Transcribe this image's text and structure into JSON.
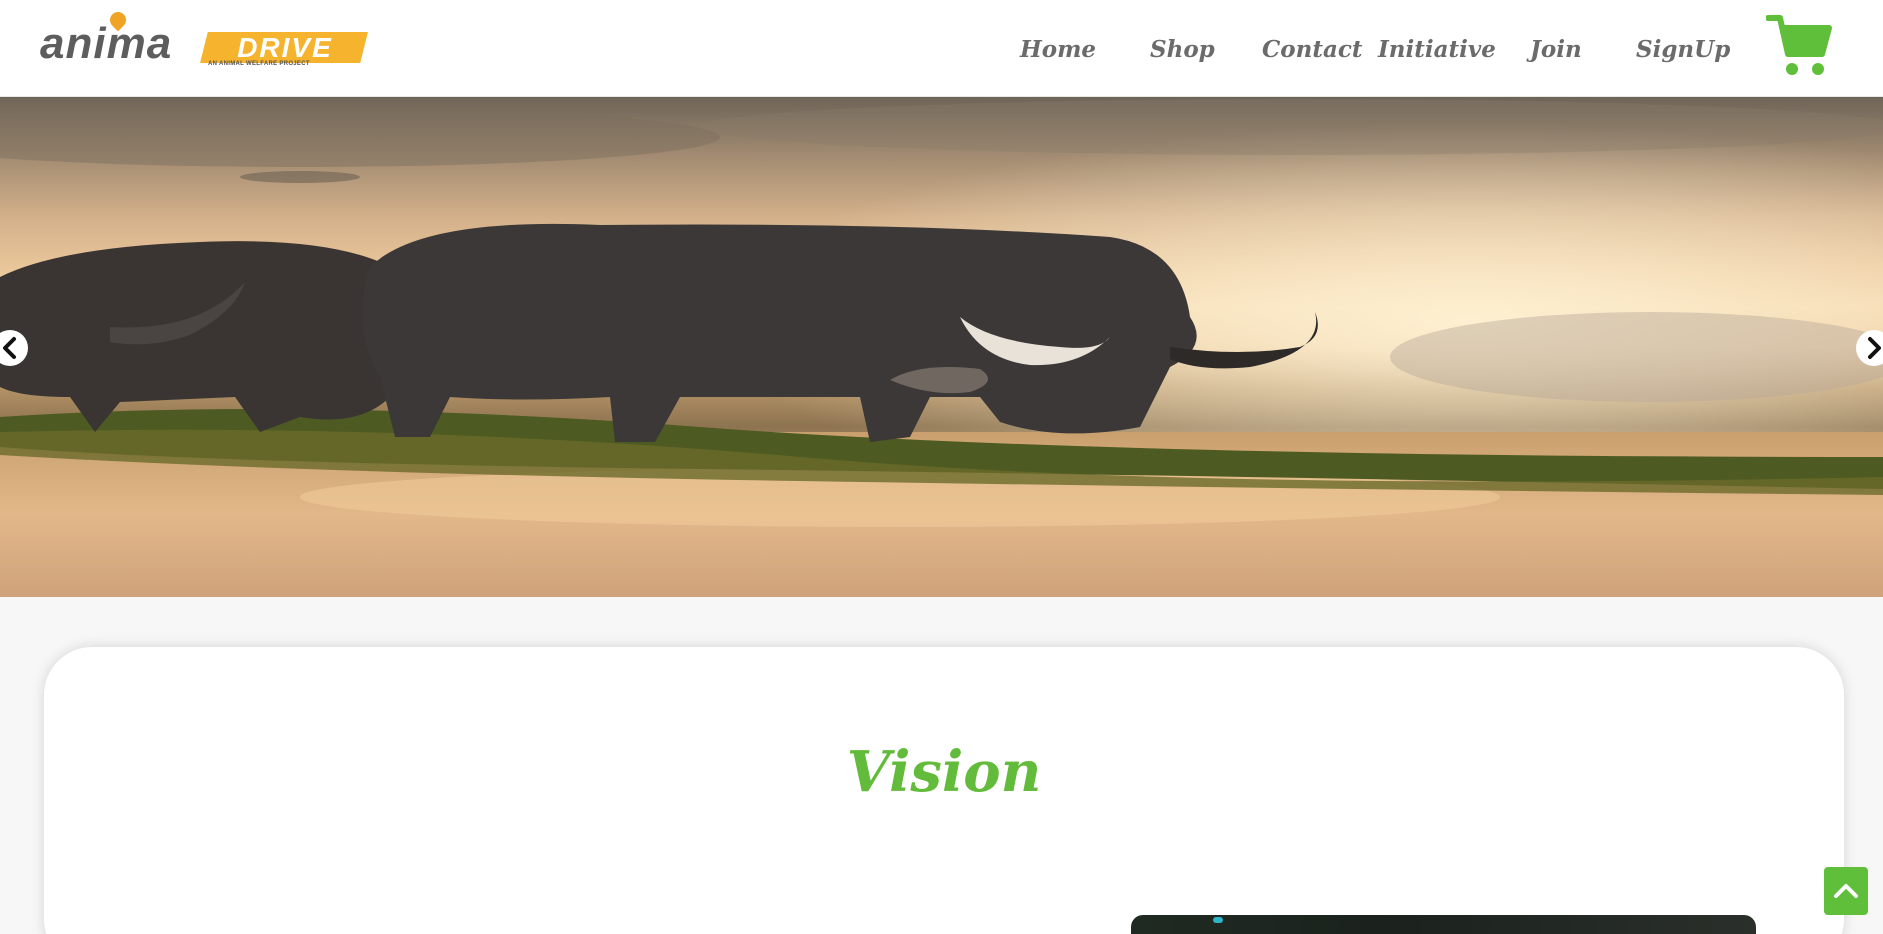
{
  "brand": {
    "logo_word": "anima",
    "logo_word_2": "DRIVE",
    "tagline": "AN ANIMAL WELFARE PROJECT",
    "primary_color": "#62bb3a",
    "accent_color": "#f6b32d"
  },
  "nav": {
    "items": [
      {
        "label": "Home"
      },
      {
        "label": "Shop"
      },
      {
        "label": "Contact"
      },
      {
        "label": "Initiative"
      },
      {
        "label": "Join"
      },
      {
        "label": "SignUp"
      }
    ],
    "cart_icon": "shopping-cart-icon"
  },
  "hero": {
    "image": "water-buffalo-at-sunset",
    "prev_icon": "chevron-left-icon",
    "next_icon": "chevron-right-icon"
  },
  "vision": {
    "title": "Vision"
  },
  "scroll_top": {
    "icon": "chevron-up-icon"
  }
}
